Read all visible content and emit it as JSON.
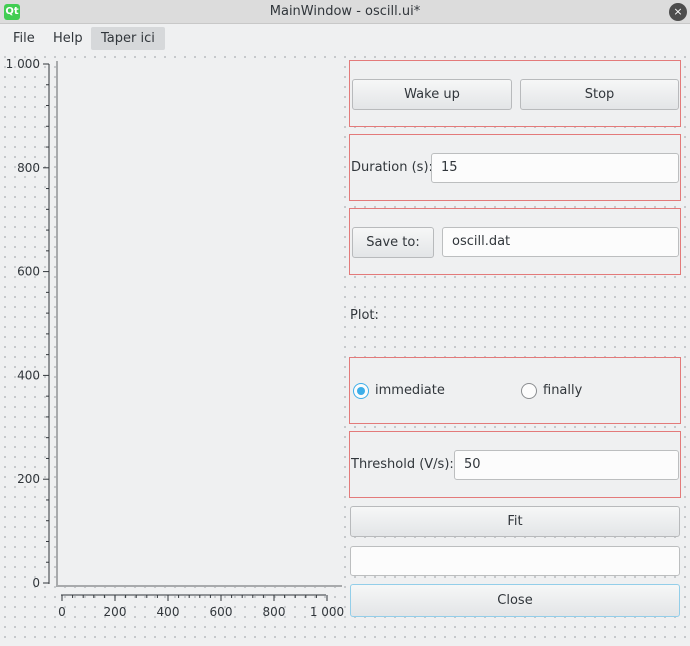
{
  "window": {
    "title": "MainWindow - oscill.ui*",
    "app_icon": "qt-designer-icon",
    "close_icon": "×"
  },
  "menu": [
    "File",
    "Help",
    "Taper ici"
  ],
  "plot": {
    "yticks": [
      "1 000",
      "800",
      "600",
      "400",
      "200",
      "0"
    ],
    "xticks": [
      "0",
      "200",
      "400",
      "600",
      "800",
      "1 000"
    ]
  },
  "controls": {
    "wake_up": "Wake up",
    "stop": "Stop",
    "duration_label": "Duration (s):",
    "duration_value": "15",
    "save_to": "Save to:",
    "save_file": "oscill.dat",
    "plot_label": "Plot:",
    "radio_immediate": "immediate",
    "radio_finally": "finally",
    "threshold_label": "Threshold (V/s):",
    "threshold_value": "50",
    "fit": "Fit",
    "result_value": "",
    "close": "Close"
  },
  "colors": {
    "accent": "#3daee9",
    "box_outline": "#e37a7a",
    "background": "#eff0f1"
  }
}
